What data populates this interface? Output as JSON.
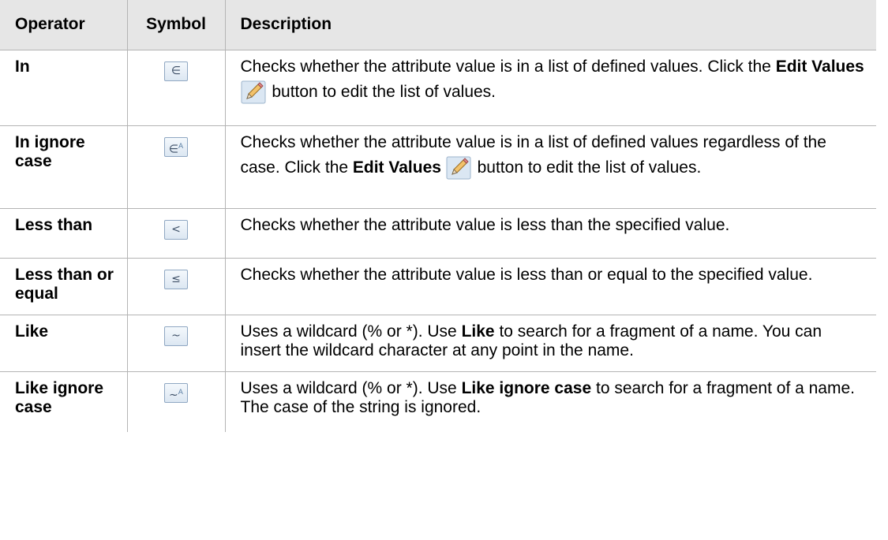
{
  "headers": {
    "operator": "Operator",
    "symbol": "Symbol",
    "description": "Description"
  },
  "rows": [
    {
      "operator": "In",
      "symbol": "∈",
      "icon": "element-of-icon",
      "desc_pre": "Checks whether the attribute value is in a list of defined values. Click the ",
      "desc_bold": "Edit Values",
      "desc_post": " button to edit the list of values."
    },
    {
      "operator": "In ignore case",
      "symbol": "∈",
      "symbol_sup": "A",
      "icon": "element-of-ignore-case-icon",
      "desc_pre": "Checks whether the attribute value is in a list of defined values regardless of the case. Click the ",
      "desc_bold": "Edit Values",
      "desc_post": " button to edit the list of values."
    },
    {
      "operator": "Less than",
      "symbol": "<",
      "icon": "less-than-icon",
      "desc": "Checks whether the attribute value is less than the specified value."
    },
    {
      "operator": "Less than or equal",
      "symbol": "≤",
      "icon": "less-than-or-equal-icon",
      "desc": "Checks whether the attribute value is less than or equal to the specified value."
    },
    {
      "operator": "Like",
      "symbol": "~",
      "icon": "tilde-icon",
      "desc_pre": "Uses a wildcard (% or *). Use ",
      "desc_bold": "Like",
      "desc_post": " to search for a fragment of a name. You can insert the wildcard character at any point in the name."
    },
    {
      "operator": "Like ignore case",
      "symbol": "~",
      "symbol_sup": "A",
      "icon": "tilde-ignore-case-icon",
      "desc_pre": "Uses a wildcard (% or *). Use ",
      "desc_bold": "Like ignore case",
      "desc_post": " to search for a fragment of a name. The case of the string is ignored."
    }
  ],
  "colors": {
    "header_bg": "#e6e6e6",
    "border": "#b4b4b4",
    "symbol_button_border": "#8fa7c2"
  }
}
